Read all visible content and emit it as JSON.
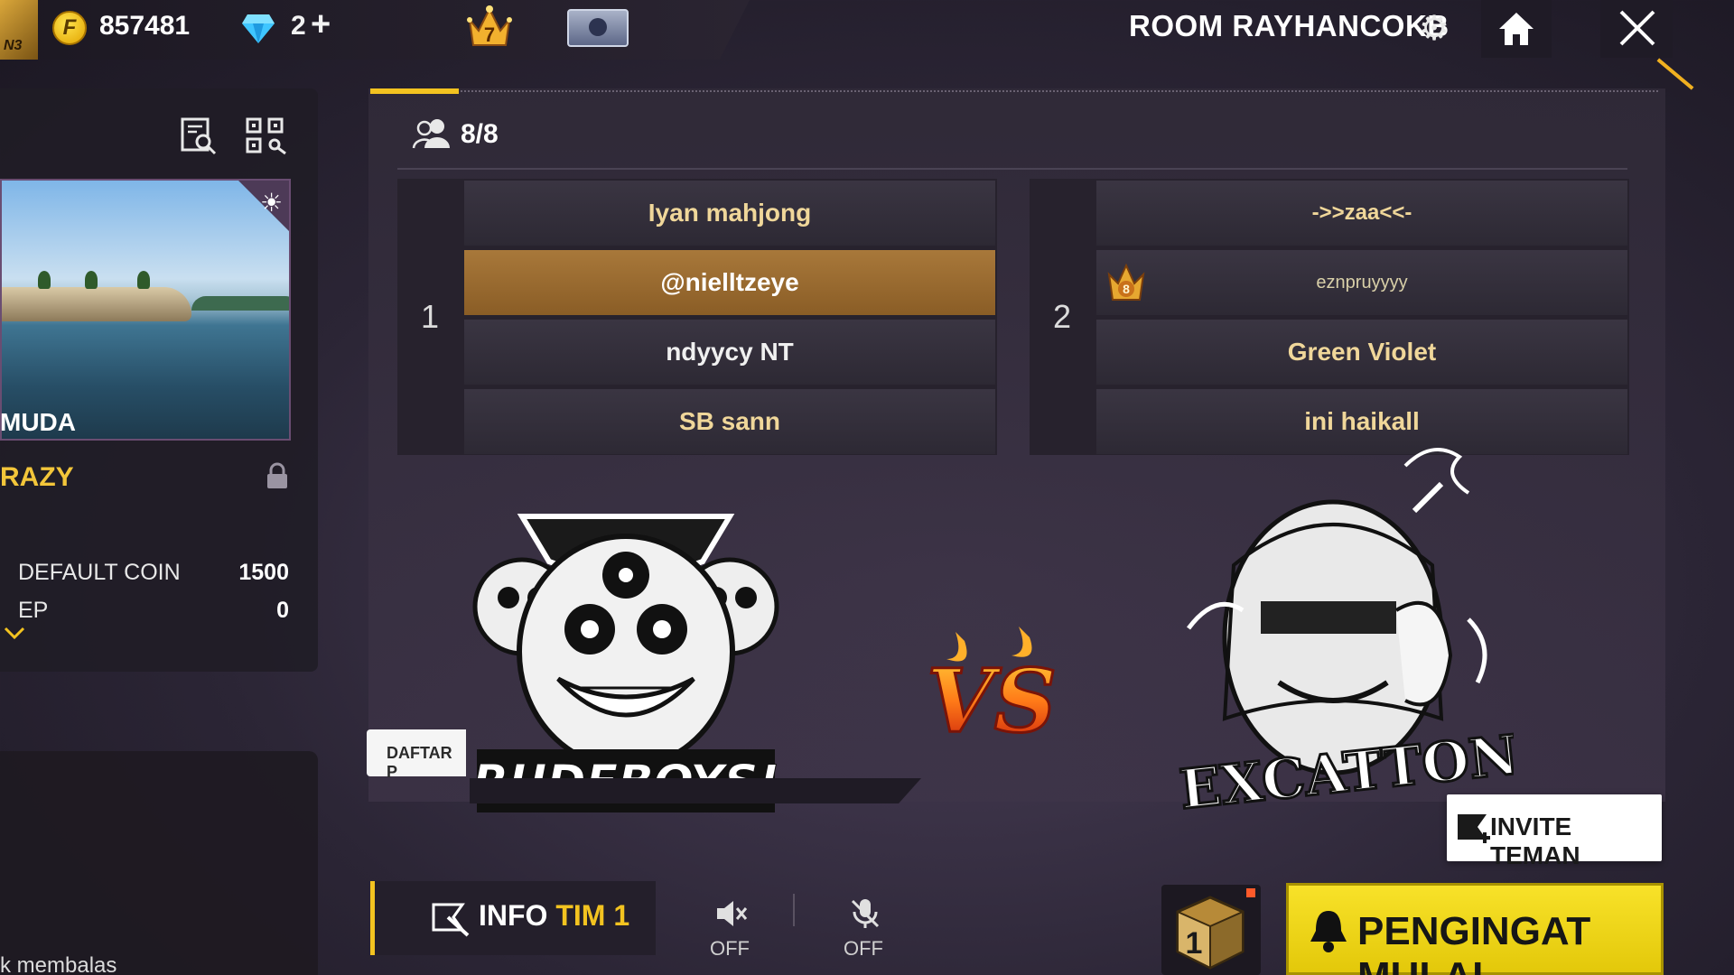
{
  "topbar": {
    "rank_tag": "N3",
    "coin_symbol": "F",
    "coins": "857481",
    "diamonds": "2",
    "diamonds_plus": "+",
    "crown_level": "7",
    "room_title": "ROOM RAYHANCOKB"
  },
  "sidebar": {
    "map_name": "MUDA",
    "mode_name": "RAZY",
    "stats": [
      {
        "label": "DEFAULT COIN",
        "value": "1500"
      },
      {
        "label": "EP",
        "value": "0"
      }
    ],
    "chat_text": "k membalas",
    "daftar_label": "DAFTAR P"
  },
  "lobby": {
    "players_count": "8/8",
    "teams": [
      {
        "number": "1",
        "players": [
          "Iyan   mahjong",
          "@nielltzeye",
          "ndyycy NT",
          "SB   sann"
        ]
      },
      {
        "number": "2",
        "players": [
          "->>zaa<<-",
          "eznpruyyyy",
          "Green Violet",
          "ini haikall"
        ]
      }
    ],
    "team2_badge_level": "8",
    "team_left_name": "RUDEBOYS!",
    "team_right_name": "EXCATTON",
    "vs_text": "VS"
  },
  "buttons": {
    "invite": "INVITE TEMAN",
    "info_prefix": "INFO ",
    "info_highlight": "TIM 1",
    "speaker_state": "OFF",
    "mic_state": "OFF",
    "box_number": "1",
    "start": "PENGINGAT MULAI"
  },
  "colors": {
    "accent_yellow": "#f3c320",
    "active_slot": "#a8783a",
    "panel_bg": "#27222d"
  }
}
